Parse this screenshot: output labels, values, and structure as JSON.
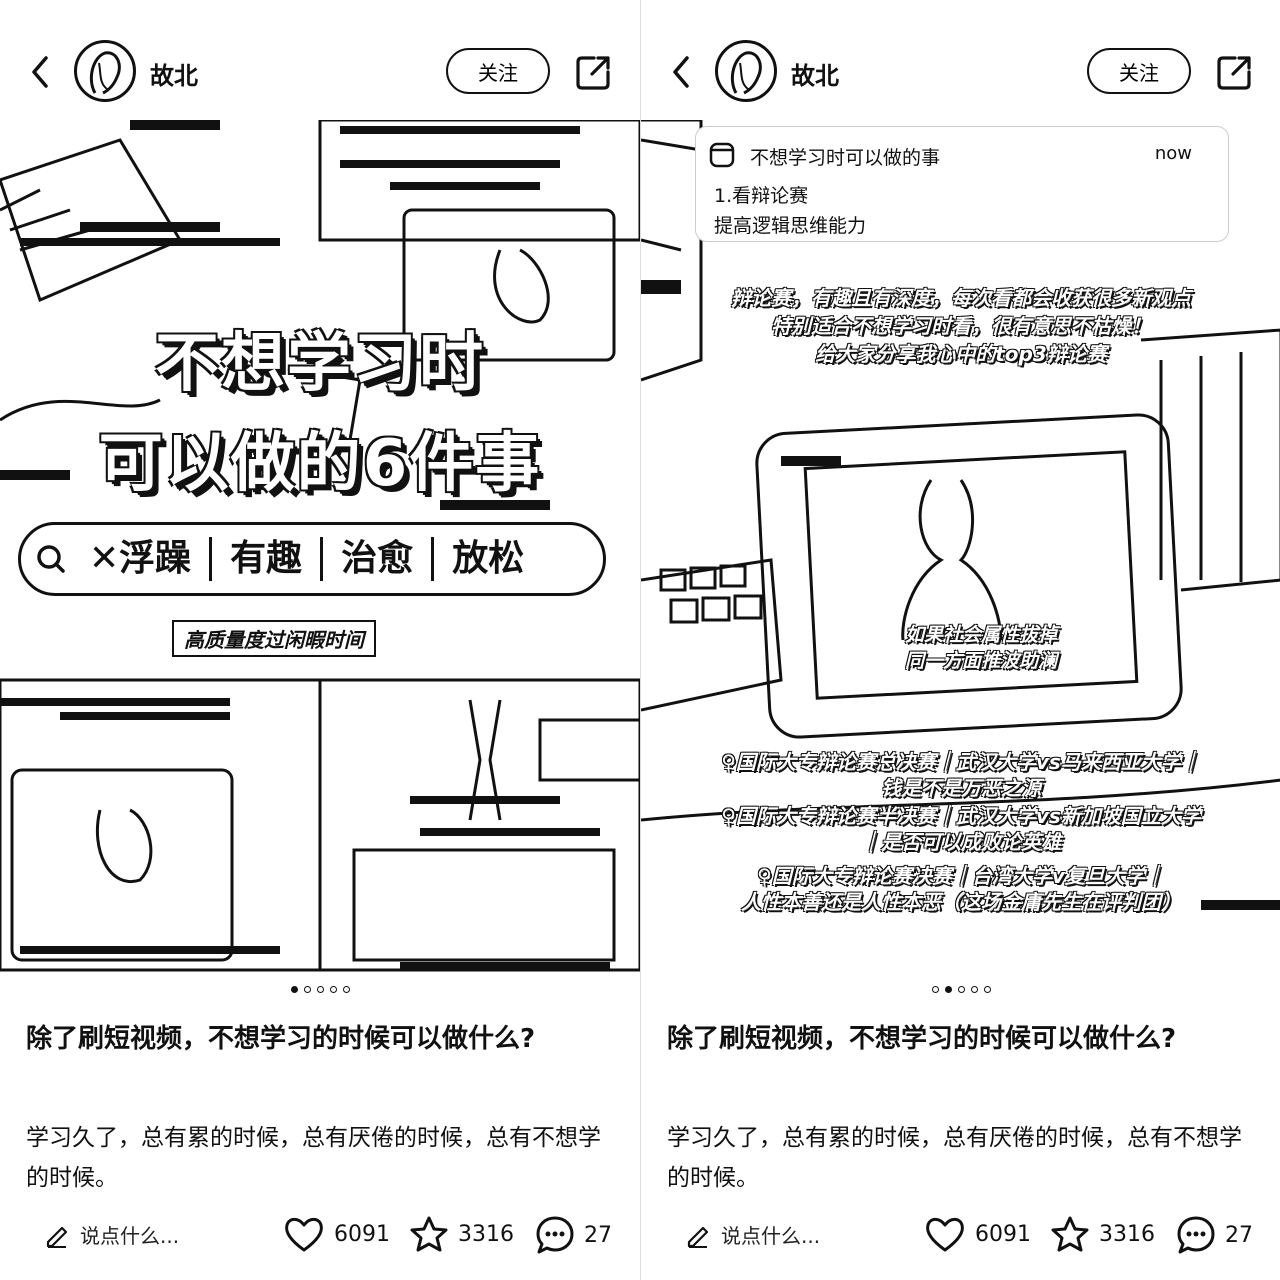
{
  "screens": [
    {
      "header": {
        "username": "故北",
        "follow_label": "关注"
      },
      "cover": {
        "title_line1": "不想学习时",
        "title_line2": "可以做的6件事",
        "search_tags": [
          "✕浮躁",
          "有趣",
          "治愈",
          "放松"
        ],
        "subtitle": "高质量度过闲暇时间"
      },
      "pager": {
        "total": 5,
        "active": 1
      },
      "post": {
        "title": "除了刷短视频，不想学习的时候可以做什么?",
        "body": "学习久了，总有累的时候，总有厌倦的时候，总有不想学的时候。"
      },
      "bottom": {
        "comment_placeholder": "说点什么...",
        "likes": "6091",
        "favorites": "3316",
        "comments": "27"
      }
    },
    {
      "header": {
        "username": "故北",
        "follow_label": "关注"
      },
      "slide": {
        "notification": {
          "title": "不想学习时可以做的事",
          "time": "now",
          "line1": "1.看辩论赛",
          "line2": "提高逻辑思维能力"
        },
        "intro": [
          "辩论赛，有趣且有深度，每次看都会收获很多新观点",
          "特别适合不想学习时看，很有意思不枯燥！",
          "给大家分享我心中的top3辩论赛"
        ],
        "video_caption": [
          "如果社会属性拔掉",
          "同一方面推波助澜"
        ],
        "list": [
          "♀国际大专辩论赛总决赛｜武汉大学vs马来西亚大学｜",
          "钱是不是万恶之源",
          "♀国际大专辩论赛半决赛｜武汉大学vs新加坡国立大学",
          "｜是否可以成败论英雄",
          "♀国际大专辩论赛决赛｜台湾大学v复旦大学｜",
          "人性本善还是人性本恶（这场金庸先生在评判团）"
        ]
      },
      "pager": {
        "total": 5,
        "active": 2
      },
      "post": {
        "title": "除了刷短视频，不想学习的时候可以做什么?",
        "body": "学习久了，总有累的时候，总有厌倦的时候，总有不想学的时候。"
      },
      "bottom": {
        "comment_placeholder": "说点什么...",
        "likes": "6091",
        "favorites": "3316",
        "comments": "27"
      }
    }
  ]
}
